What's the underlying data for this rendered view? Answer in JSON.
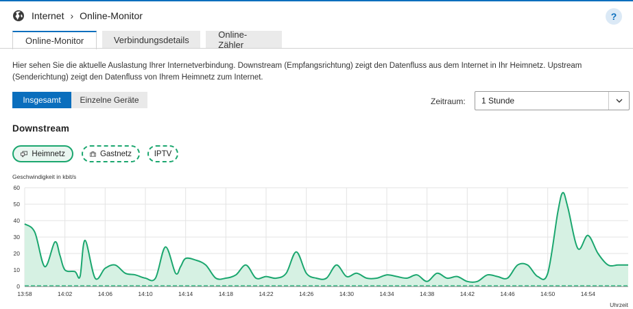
{
  "breadcrumb": {
    "root": "Internet",
    "current": "Online-Monitor"
  },
  "help": {
    "label": "?"
  },
  "tabs": [
    {
      "label": "Online-Monitor",
      "active": true
    },
    {
      "label": "Verbindungsdetails",
      "active": false
    },
    {
      "label": "Online-Zähler",
      "active": false
    }
  ],
  "intro": "Hier sehen Sie die aktuelle Auslastung Ihrer Internetverbindung. Downstream (Empfangsrichtung) zeigt den Datenfluss aus dem Internet in Ihr Heimnetz. Upstream (Senderichtung) zeigt den Datenfluss von Ihrem Heimnetz zum Internet.",
  "view": {
    "all": "Insgesamt",
    "devices": "Einzelne Geräte"
  },
  "zeitraum": {
    "label": "Zeitraum:",
    "value": "1 Stunde"
  },
  "section": {
    "title": "Downstream"
  },
  "filters": {
    "heimnetz": "Heimnetz",
    "gastnetz": "Gastnetz",
    "iptv": "IPTV"
  },
  "colors": {
    "accent": "#0a6ebd",
    "series": "#1aa66e",
    "fill": "#d6f1e3"
  },
  "chart_data": {
    "type": "area",
    "ylabel": "Geschwindigkeit in kbit/s",
    "xlabel": "Uhrzeit",
    "ylim": [
      0,
      60
    ],
    "yticks": [
      "0",
      "10",
      "20",
      "30",
      "40",
      "50",
      "60"
    ],
    "xticks": [
      "13:58",
      "14:02",
      "14:06",
      "14:10",
      "14:14",
      "14:18",
      "14:22",
      "14:26",
      "14:30",
      "14:34",
      "14:38",
      "14:42",
      "14:46",
      "14:50",
      "14:54"
    ],
    "x_minutes": [
      0,
      1,
      2,
      3,
      3.5,
      4,
      5,
      5.5,
      6,
      7,
      8,
      9,
      10,
      11,
      12,
      13,
      14,
      15,
      15.5,
      16,
      17,
      18,
      19,
      20,
      21,
      22,
      23,
      24,
      25,
      26,
      27,
      28,
      29,
      30,
      31,
      32,
      33,
      34,
      35,
      36,
      37,
      38,
      39,
      40,
      41,
      42,
      43,
      44,
      45,
      46,
      47,
      48,
      49,
      50,
      51,
      52,
      53,
      53.5,
      54,
      55,
      56,
      57,
      58,
      59,
      60
    ],
    "series": [
      {
        "values": [
          38,
          33,
          12,
          27,
          19,
          10,
          9,
          6,
          28,
          5,
          11,
          13,
          8,
          7,
          5,
          5,
          24,
          8,
          12,
          17,
          16,
          13,
          5,
          5,
          7,
          13,
          5,
          6,
          5,
          8,
          21,
          8,
          5,
          5,
          13,
          6,
          8,
          5,
          5,
          7,
          6,
          5,
          7,
          3,
          8,
          5,
          6,
          3,
          3,
          7,
          6,
          5,
          13,
          13,
          6,
          8,
          45,
          57,
          48,
          23,
          31,
          20,
          13,
          13,
          13
        ]
      }
    ]
  }
}
